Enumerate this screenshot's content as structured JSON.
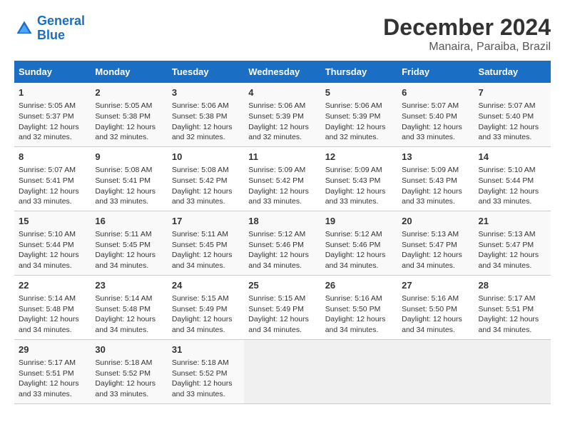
{
  "header": {
    "logo_line1": "General",
    "logo_line2": "Blue",
    "title": "December 2024",
    "subtitle": "Manaira, Paraiba, Brazil"
  },
  "calendar": {
    "headers": [
      "Sunday",
      "Monday",
      "Tuesday",
      "Wednesday",
      "Thursday",
      "Friday",
      "Saturday"
    ],
    "weeks": [
      [
        {
          "day": 1,
          "sunrise": "5:05 AM",
          "sunset": "5:37 PM",
          "daylight": "12 hours and 32 minutes."
        },
        {
          "day": 2,
          "sunrise": "5:05 AM",
          "sunset": "5:38 PM",
          "daylight": "12 hours and 32 minutes."
        },
        {
          "day": 3,
          "sunrise": "5:06 AM",
          "sunset": "5:38 PM",
          "daylight": "12 hours and 32 minutes."
        },
        {
          "day": 4,
          "sunrise": "5:06 AM",
          "sunset": "5:39 PM",
          "daylight": "12 hours and 32 minutes."
        },
        {
          "day": 5,
          "sunrise": "5:06 AM",
          "sunset": "5:39 PM",
          "daylight": "12 hours and 32 minutes."
        },
        {
          "day": 6,
          "sunrise": "5:07 AM",
          "sunset": "5:40 PM",
          "daylight": "12 hours and 33 minutes."
        },
        {
          "day": 7,
          "sunrise": "5:07 AM",
          "sunset": "5:40 PM",
          "daylight": "12 hours and 33 minutes."
        }
      ],
      [
        {
          "day": 8,
          "sunrise": "5:07 AM",
          "sunset": "5:41 PM",
          "daylight": "12 hours and 33 minutes."
        },
        {
          "day": 9,
          "sunrise": "5:08 AM",
          "sunset": "5:41 PM",
          "daylight": "12 hours and 33 minutes."
        },
        {
          "day": 10,
          "sunrise": "5:08 AM",
          "sunset": "5:42 PM",
          "daylight": "12 hours and 33 minutes."
        },
        {
          "day": 11,
          "sunrise": "5:09 AM",
          "sunset": "5:42 PM",
          "daylight": "12 hours and 33 minutes."
        },
        {
          "day": 12,
          "sunrise": "5:09 AM",
          "sunset": "5:43 PM",
          "daylight": "12 hours and 33 minutes."
        },
        {
          "day": 13,
          "sunrise": "5:09 AM",
          "sunset": "5:43 PM",
          "daylight": "12 hours and 33 minutes."
        },
        {
          "day": 14,
          "sunrise": "5:10 AM",
          "sunset": "5:44 PM",
          "daylight": "12 hours and 33 minutes."
        }
      ],
      [
        {
          "day": 15,
          "sunrise": "5:10 AM",
          "sunset": "5:44 PM",
          "daylight": "12 hours and 34 minutes."
        },
        {
          "day": 16,
          "sunrise": "5:11 AM",
          "sunset": "5:45 PM",
          "daylight": "12 hours and 34 minutes."
        },
        {
          "day": 17,
          "sunrise": "5:11 AM",
          "sunset": "5:45 PM",
          "daylight": "12 hours and 34 minutes."
        },
        {
          "day": 18,
          "sunrise": "5:12 AM",
          "sunset": "5:46 PM",
          "daylight": "12 hours and 34 minutes."
        },
        {
          "day": 19,
          "sunrise": "5:12 AM",
          "sunset": "5:46 PM",
          "daylight": "12 hours and 34 minutes."
        },
        {
          "day": 20,
          "sunrise": "5:13 AM",
          "sunset": "5:47 PM",
          "daylight": "12 hours and 34 minutes."
        },
        {
          "day": 21,
          "sunrise": "5:13 AM",
          "sunset": "5:47 PM",
          "daylight": "12 hours and 34 minutes."
        }
      ],
      [
        {
          "day": 22,
          "sunrise": "5:14 AM",
          "sunset": "5:48 PM",
          "daylight": "12 hours and 34 minutes."
        },
        {
          "day": 23,
          "sunrise": "5:14 AM",
          "sunset": "5:48 PM",
          "daylight": "12 hours and 34 minutes."
        },
        {
          "day": 24,
          "sunrise": "5:15 AM",
          "sunset": "5:49 PM",
          "daylight": "12 hours and 34 minutes."
        },
        {
          "day": 25,
          "sunrise": "5:15 AM",
          "sunset": "5:49 PM",
          "daylight": "12 hours and 34 minutes."
        },
        {
          "day": 26,
          "sunrise": "5:16 AM",
          "sunset": "5:50 PM",
          "daylight": "12 hours and 34 minutes."
        },
        {
          "day": 27,
          "sunrise": "5:16 AM",
          "sunset": "5:50 PM",
          "daylight": "12 hours and 34 minutes."
        },
        {
          "day": 28,
          "sunrise": "5:17 AM",
          "sunset": "5:51 PM",
          "daylight": "12 hours and 34 minutes."
        }
      ],
      [
        {
          "day": 29,
          "sunrise": "5:17 AM",
          "sunset": "5:51 PM",
          "daylight": "12 hours and 33 minutes."
        },
        {
          "day": 30,
          "sunrise": "5:18 AM",
          "sunset": "5:52 PM",
          "daylight": "12 hours and 33 minutes."
        },
        {
          "day": 31,
          "sunrise": "5:18 AM",
          "sunset": "5:52 PM",
          "daylight": "12 hours and 33 minutes."
        },
        null,
        null,
        null,
        null
      ]
    ]
  }
}
